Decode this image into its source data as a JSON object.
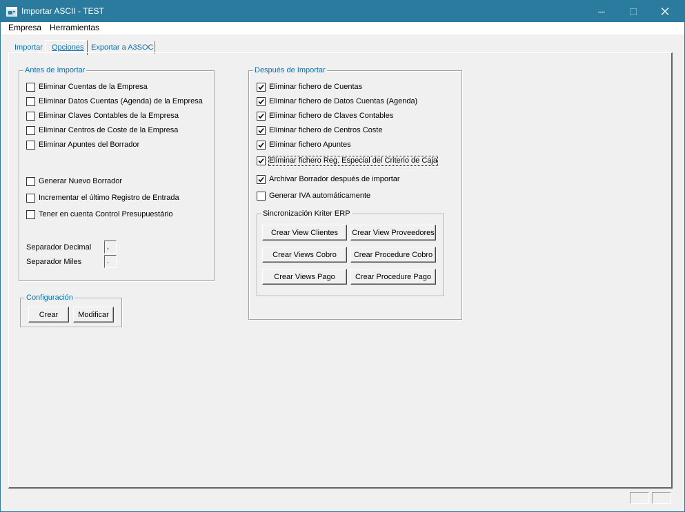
{
  "window": {
    "title": "Importar ASCII - TEST",
    "titlebar_color": "#2b7b9e",
    "controls": [
      "minimize-icon",
      "maximize-icon",
      "close-icon"
    ]
  },
  "menu": {
    "items": [
      "Empresa",
      "Herramientas"
    ]
  },
  "tabs": {
    "items": [
      "Importar",
      "Opciones",
      "Exportar a A3SOC"
    ],
    "active": "Opciones"
  },
  "antes": {
    "caption": "Antes de Importar",
    "options": [
      {
        "label": "Eliminar Cuentas de la Empresa",
        "checked": false
      },
      {
        "label": "Eliminar Datos Cuentas (Agenda) de la Empresa",
        "checked": false
      },
      {
        "label": "Eliminar Claves Contables de la Empresa",
        "checked": false
      },
      {
        "label": "Eliminar Centros de Coste de la Empresa",
        "checked": false
      },
      {
        "label": "Eliminar Apuntes del Borrador",
        "checked": false
      },
      {
        "label": "Generar Nuevo Borrador",
        "checked": false
      },
      {
        "label": "Incrementar el último Registro de Entrada",
        "checked": false
      },
      {
        "label": "Tener en cuenta Control Presupuestário",
        "checked": false
      }
    ],
    "separador_decimal": {
      "label": "Separador Decimal",
      "value": ","
    },
    "separador_miles": {
      "label": "Separador Miles",
      "value": "."
    }
  },
  "configuracion": {
    "caption": "Configuración",
    "crear_label": "Crear",
    "modificar_label": "Modificar"
  },
  "despues": {
    "caption": "Después de Importar",
    "options": [
      {
        "label": "Eliminar fichero de Cuentas",
        "checked": true
      },
      {
        "label": "Eliminar fichero de Datos Cuentas (Agenda)",
        "checked": true
      },
      {
        "label": "Eliminar fichero de Claves Contables",
        "checked": true
      },
      {
        "label": "Eliminar fichero de Centros Coste",
        "checked": true
      },
      {
        "label": "Eliminar fichero Apuntes",
        "checked": true
      },
      {
        "label": "Eliminar fichero Reg. Especial del Criterio de Caja",
        "checked": true
      },
      {
        "label": "Archivar Borrador después de importar",
        "checked": true
      },
      {
        "label": "Generar IVA automáticamente",
        "checked": false
      }
    ]
  },
  "sincronizacion": {
    "caption": "Sincronización Kriter ERP",
    "buttons": [
      "Crear View Clientes",
      "Crear View Proveedores",
      "Crear Views  Cobro",
      "Crear Procedure Cobro",
      "Crear Views  Pago",
      "Crear Procedure Pago"
    ]
  }
}
